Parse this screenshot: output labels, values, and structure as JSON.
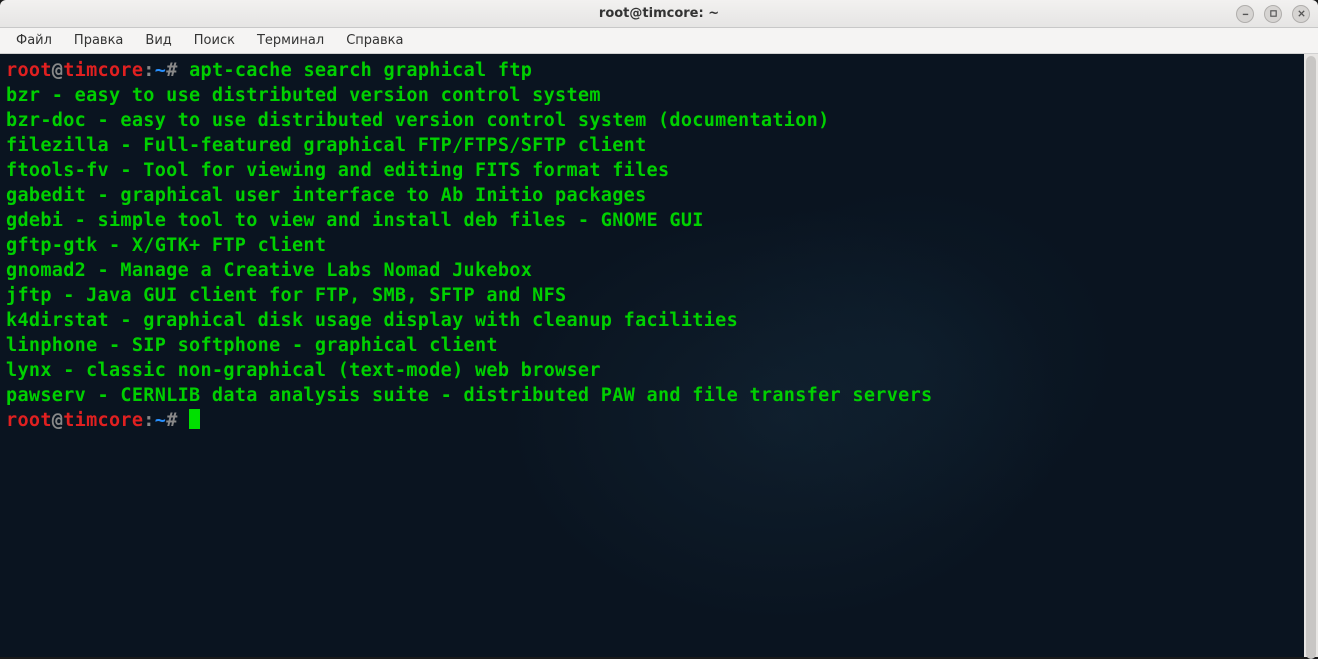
{
  "titlebar": {
    "title": "root@timcore: ~"
  },
  "menu": {
    "file": "Файл",
    "edit": "Правка",
    "view": "Вид",
    "search": "Поиск",
    "terminal": "Терминал",
    "help": "Справка"
  },
  "prompt": {
    "user": "root",
    "at": "@",
    "host": "timcore",
    "colon": ":",
    "path": "~",
    "hash": "#"
  },
  "commands": {
    "c1": "apt-cache search graphical ftp"
  },
  "output": {
    "l1": "bzr - easy to use distributed version control system",
    "l2": "bzr-doc - easy to use distributed version control system (documentation)",
    "l3": "filezilla - Full-featured graphical FTP/FTPS/SFTP client",
    "l4": "ftools-fv - Tool for viewing and editing FITS format files",
    "l5": "gabedit - graphical user interface to Ab Initio packages",
    "l6": "gdebi - simple tool to view and install deb files - GNOME GUI",
    "l7": "gftp-gtk - X/GTK+ FTP client",
    "l8": "gnomad2 - Manage a Creative Labs Nomad Jukebox",
    "l9": "jftp - Java GUI client for FTP, SMB, SFTP and NFS",
    "l10": "k4dirstat - graphical disk usage display with cleanup facilities",
    "l11": "linphone - SIP softphone - graphical client",
    "l12": "lynx - classic non-graphical (text-mode) web browser",
    "l13": "pawserv - CERNLIB data analysis suite - distributed PAW and file transfer servers"
  }
}
